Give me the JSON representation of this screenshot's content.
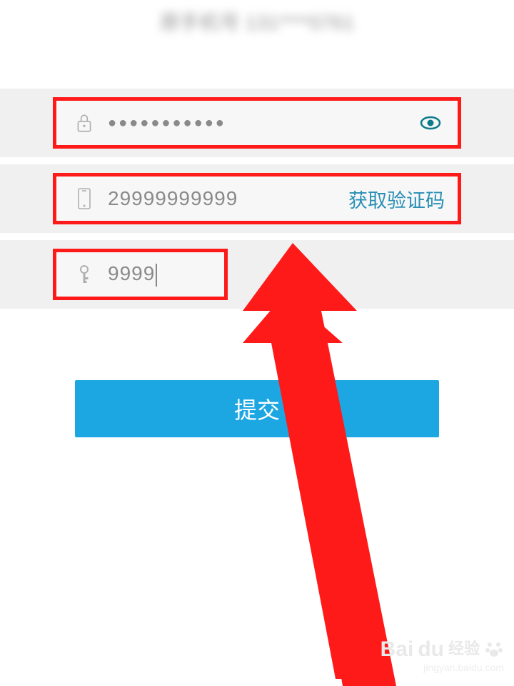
{
  "header": {
    "label": "原手机号 131****0761"
  },
  "password": {
    "masked_value": "●●●●●●●●●●●"
  },
  "phone": {
    "value": "29999999999",
    "action_label": "获取验证码"
  },
  "code": {
    "value": "9999"
  },
  "submit": {
    "label": "提交"
  },
  "watermark": {
    "brand_main": "Bai",
    "brand_du": "du",
    "brand_cn": "经验",
    "url": "jingyan.baidu.com"
  }
}
